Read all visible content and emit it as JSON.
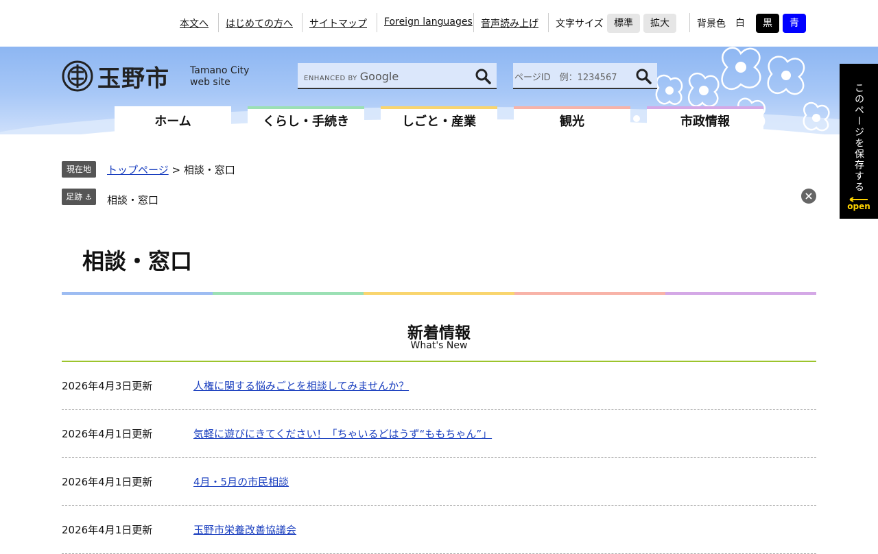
{
  "utility": {
    "links": [
      "本文へ",
      "はじめての方へ",
      "サイトマップ",
      "Foreign languages",
      "音声読み上げ"
    ],
    "text_size_label": "文字サイズ",
    "text_size_standard": "標準",
    "text_size_large": "拡大",
    "bg_color_label": "背景色",
    "bg_white": "白",
    "bg_black": "黒",
    "bg_blue": "青"
  },
  "header": {
    "logo_text": "玉野市",
    "logo_sub_line1": "Tamano City",
    "logo_sub_line2": "web site",
    "google_search_en": "ENHANCED BY",
    "google_search_brand": "Google",
    "page_id_placeholder": "ページID　例：1234567"
  },
  "nav": {
    "tabs": [
      {
        "label": "ホーム",
        "color": "#ffffff"
      },
      {
        "label": "くらし・手続き",
        "color": "#9be0b4"
      },
      {
        "label": "しごと・産業",
        "color": "#f9d56e"
      },
      {
        "label": "観光",
        "color": "#f8b3a8"
      },
      {
        "label": "市政情報",
        "color": "#d4a8e6"
      }
    ]
  },
  "side_panel": {
    "text": "このページを保存する",
    "open_label": "open"
  },
  "breadcrumb": {
    "current_label": "現在地",
    "home_link": "トップページ",
    "separator": ">",
    "current_page": "相談・窓口",
    "history_label": "足跡",
    "history_item": "相談・窓口"
  },
  "page": {
    "title": "相談・窓口",
    "rainbow_colors": [
      "#9dbcf2",
      "#9be0b4",
      "#f9d56e",
      "#f8b3a8",
      "#d4a8e6"
    ]
  },
  "news": {
    "title": "新着情報",
    "subtitle": "What's New",
    "items": [
      {
        "date": "2026年4月3日更新",
        "title": "人権に関する悩みごとを相談してみませんか？"
      },
      {
        "date": "2026年4月1日更新",
        "title": "気軽に遊びにきてください！「ちゃいるどはうず“ももちゃん”」"
      },
      {
        "date": "2026年4月1日更新",
        "title": "4月・5月の市民相談"
      },
      {
        "date": "2026年4月1日更新",
        "title": "玉野市栄養改善協議会"
      }
    ]
  }
}
